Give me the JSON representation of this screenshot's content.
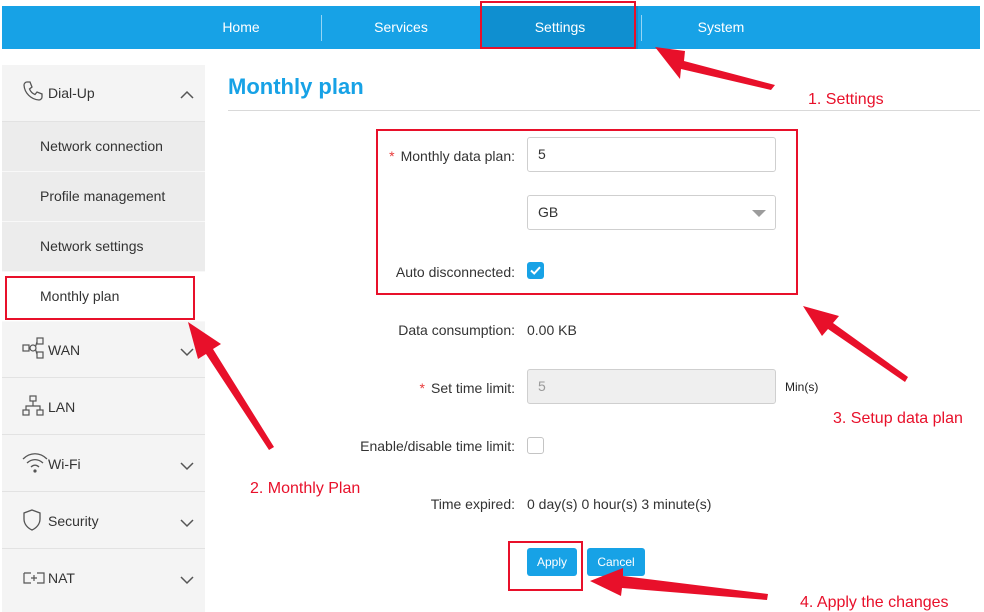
{
  "nav": {
    "tabs": [
      {
        "label": "Home"
      },
      {
        "label": "Services"
      },
      {
        "label": "Settings",
        "active": true
      },
      {
        "label": "System"
      }
    ]
  },
  "sidebar": {
    "dialup": {
      "label": "Dial-Up",
      "items": [
        {
          "label": "Network connection"
        },
        {
          "label": "Profile management"
        },
        {
          "label": "Network settings"
        },
        {
          "label": "Monthly plan",
          "active": true
        }
      ]
    },
    "wan": {
      "label": "WAN"
    },
    "lan": {
      "label": "LAN"
    },
    "wifi": {
      "label": "Wi-Fi"
    },
    "security": {
      "label": "Security"
    },
    "nat": {
      "label": "NAT"
    }
  },
  "page": {
    "title": "Monthly plan"
  },
  "form": {
    "required_mark": "*",
    "monthly_data_plan_label": "Monthly data plan:",
    "monthly_data_plan_value": "5",
    "unit_value": "GB",
    "auto_disconnect_label": "Auto disconnected:",
    "auto_disconnect_checked": true,
    "consumption_label": "Data consumption:",
    "consumption_value": "0.00 KB",
    "time_limit_label": "Set time limit:",
    "time_limit_value": "5",
    "time_limit_unit": "Min(s)",
    "enable_time_limit_label": "Enable/disable time limit:",
    "enable_time_limit_checked": false,
    "time_expired_label": "Time expired:",
    "time_expired_value": "0 day(s) 0 hour(s) 3 minute(s)",
    "apply_label": "Apply",
    "cancel_label": "Cancel"
  },
  "annotations": {
    "step1": "1. Settings",
    "step2": "2. Monthly Plan",
    "step3": "3. Setup data plan",
    "step4": "4. Apply the changes"
  },
  "colors": {
    "brand": "#17a2e6",
    "annotation": "#e8102a"
  }
}
